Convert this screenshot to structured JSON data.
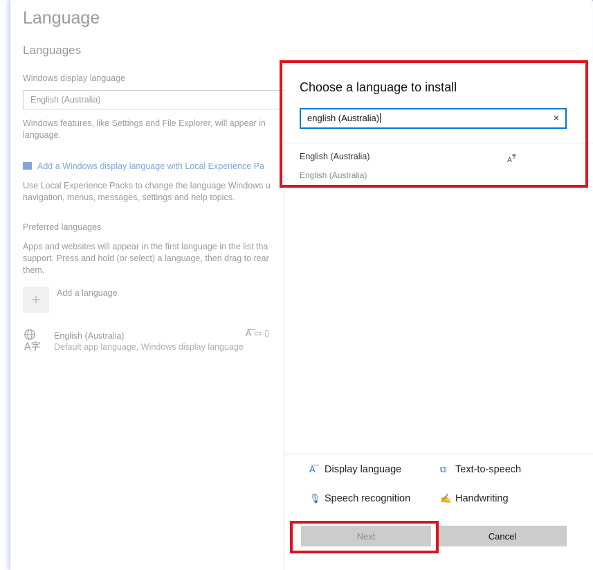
{
  "settings": {
    "page_title": "Language",
    "section_title": "Languages",
    "display_language_label": "Windows display language",
    "display_language_value": "English (Australia)",
    "display_language_desc_1": "Windows features, like Settings and File Explorer, will appear in",
    "display_language_desc_2": "language.",
    "lxp_link": "Add a Windows display language with Local Experience Pa",
    "lxp_desc_1": "Use Local Experience Packs to change the language Windows u",
    "lxp_desc_2": "navigation, menus, messages, settings and help topics.",
    "preferred_label": "Preferred languages",
    "preferred_desc_1": "Apps and websites will appear in the first language in the list tha",
    "preferred_desc_2": "support. Press and hold (or select) a language, then drag to rear",
    "preferred_desc_3": "them.",
    "add_language_label": "Add a language",
    "installed_language": {
      "name": "English (Australia)",
      "description": "Default app language, Windows display language",
      "icon": "language-glyph-icon"
    }
  },
  "dialog": {
    "title": "Choose a language to install",
    "search_value": "english (Australia)",
    "clear_glyph": "×",
    "result": {
      "name": "English (Australia)",
      "native_name": "English (Australia)",
      "capability_icon": "display-language-icon"
    },
    "features": {
      "display_language": "Display language",
      "text_to_speech": "Text-to-speech",
      "speech_recognition": "Speech recognition",
      "handwriting": "Handwriting"
    },
    "buttons": {
      "next": "Next",
      "cancel": "Cancel"
    }
  },
  "colors": {
    "accent": "#0078d7",
    "highlight": "#e0141e",
    "link": "#7fa7d9"
  }
}
